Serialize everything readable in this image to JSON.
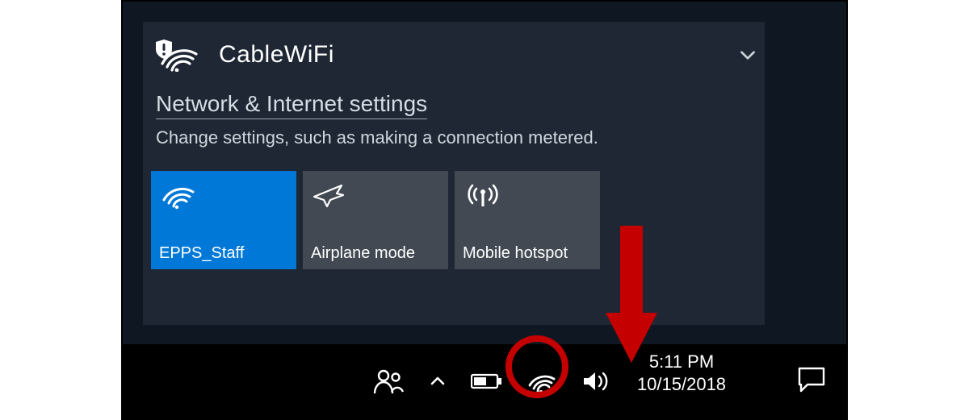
{
  "flyout": {
    "network": {
      "name": "CableWiFi"
    },
    "settings": {
      "link_text": "Network & Internet settings",
      "caption": "Change settings, such as making a connection metered."
    },
    "tiles": {
      "wifi": {
        "label": "EPPS_Staff",
        "active": true
      },
      "airplane": {
        "label": "Airplane mode",
        "active": false
      },
      "hotspot": {
        "label": "Mobile hotspot",
        "active": false
      }
    }
  },
  "taskbar": {
    "time": "5:11 PM",
    "date": "10/15/2018"
  },
  "annotation": {
    "highlight_target": "wifi tray icon",
    "color": "#c40000"
  }
}
